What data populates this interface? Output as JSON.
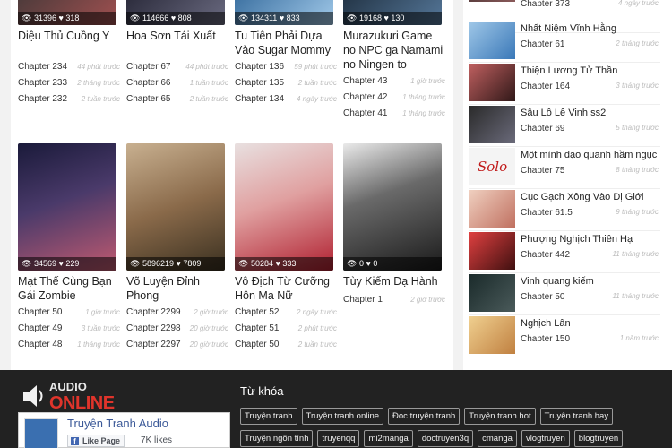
{
  "grid": {
    "row1": [
      {
        "views": "31396",
        "likes": "318",
        "title": "Diệu Thủ Cuồng Y",
        "chapters": [
          {
            "ch": "Chapter 234",
            "time": "44 phút trước"
          },
          {
            "ch": "Chapter 233",
            "time": "2 tháng trước"
          },
          {
            "ch": "Chapter 232",
            "time": "2 tuần trước"
          }
        ]
      },
      {
        "views": "114666",
        "likes": "808",
        "title": "Hoa Sơn Tái Xuất",
        "chapters": [
          {
            "ch": "Chapter 67",
            "time": "44 phút trước"
          },
          {
            "ch": "Chapter 66",
            "time": "1 tuần trước"
          },
          {
            "ch": "Chapter 65",
            "time": "2 tuần trước"
          }
        ]
      },
      {
        "views": "134311",
        "likes": "833",
        "title": "Tu Tiên Phải Dựa Vào Sugar Mommy",
        "chapters": [
          {
            "ch": "Chapter 136",
            "time": "59 phút trước"
          },
          {
            "ch": "Chapter 135",
            "time": "2 tuần trước"
          },
          {
            "ch": "Chapter 134",
            "time": "4 ngày trước"
          }
        ]
      },
      {
        "views": "19168",
        "likes": "130",
        "title": "Murazukuri Game no NPC ga Namami no Ningen to Shika...",
        "chapters": [
          {
            "ch": "Chapter 43",
            "time": "1 giờ trước"
          },
          {
            "ch": "Chapter 42",
            "time": "1 tháng trước"
          },
          {
            "ch": "Chapter 41",
            "time": "1 tháng trước"
          }
        ]
      }
    ],
    "row2": [
      {
        "views": "34569",
        "likes": "229",
        "title": "Mạt Thế Cùng Bạn Gái Zombie",
        "chapters": [
          {
            "ch": "Chapter 50",
            "time": "1 giờ trước"
          },
          {
            "ch": "Chapter 49",
            "time": "3 tuần trước"
          },
          {
            "ch": "Chapter 48",
            "time": "1 tháng trước"
          }
        ]
      },
      {
        "views": "5896219",
        "likes": "7809",
        "title": "Võ Luyện Đỉnh Phong",
        "chapters": [
          {
            "ch": "Chapter 2299",
            "time": "2 giờ trước"
          },
          {
            "ch": "Chapter 2298",
            "time": "20 giờ trước"
          },
          {
            "ch": "Chapter 2297",
            "time": "20 giờ trước"
          }
        ]
      },
      {
        "views": "50284",
        "likes": "333",
        "title": "Vô Địch Từ Cưỡng Hôn Ma Nữ",
        "chapters": [
          {
            "ch": "Chapter 52",
            "time": "2 ngày trước"
          },
          {
            "ch": "Chapter 51",
            "time": "2 phút trước"
          },
          {
            "ch": "Chapter 50",
            "time": "2 tuần trước"
          }
        ]
      },
      {
        "views": "0",
        "likes": "0",
        "title": "Tùy Kiếm Dạ Hành",
        "chapters": [
          {
            "ch": "Chapter 1",
            "time": "2 giờ trước"
          }
        ]
      }
    ]
  },
  "sidebar": [
    {
      "name": "",
      "ch": "Chapter 373",
      "time": "4 ngày trước"
    },
    {
      "name": "Nhất Niệm Vĩnh Hằng",
      "ch": "Chapter 61",
      "time": "2 tháng trước"
    },
    {
      "name": "Thiện Lương Tử Thần",
      "ch": "Chapter 164",
      "time": "3 tháng trước"
    },
    {
      "name": "Sâu Lô Lê Vinh ss2",
      "ch": "Chapter 69",
      "time": "5 tháng trước"
    },
    {
      "name": "Một mình dạo quanh hầm ngục",
      "ch": "Chapter 75",
      "time": "8 tháng trước"
    },
    {
      "name": "Cục Gạch Xông Vào Dị Giới",
      "ch": "Chapter 61.5",
      "time": "9 tháng trước"
    },
    {
      "name": "Phượng Nghịch Thiên Hạ",
      "ch": "Chapter 442",
      "time": "11 tháng trước"
    },
    {
      "name": "Vinh quang kiếm",
      "ch": "Chapter 50",
      "time": "11 tháng trước"
    },
    {
      "name": "Nghịch Lân",
      "ch": "Chapter 150",
      "time": "1 năm trước"
    }
  ],
  "footer": {
    "logo_top": "AUDIO",
    "logo_bottom": "ONLINE",
    "fb_name": "Truyện Tranh Audio",
    "fb_like": "Like Page",
    "fb_likes": "7K likes",
    "keywords_title": "Từ khóa",
    "tags": [
      "Truyện tranh",
      "Truyện tranh online",
      "Đọc truyện tranh",
      "Truyện tranh hot",
      "Truyện tranh hay",
      "Truyện ngôn tình",
      "truyenqq",
      "mi2manga",
      "doctruyen3q",
      "cmanga",
      "vlogtruyen",
      "blogtruyen"
    ]
  },
  "colors": {
    "accent": "#e0342b",
    "footer_bg": "#222222",
    "fb_blue": "#3b5998"
  }
}
